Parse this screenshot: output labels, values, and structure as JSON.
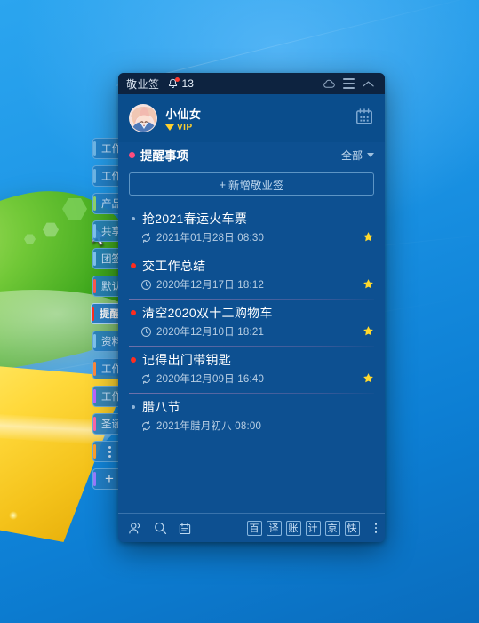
{
  "desktop": {
    "wallpaper_name": "windows-flag-wallpaper",
    "cursor": "arrow-cursor",
    "category_panel": {
      "items": [
        {
          "label": "工作",
          "accent": "#6fb8e8",
          "active": false
        },
        {
          "label": "工作",
          "accent": "#6fb8e8",
          "active": false
        },
        {
          "label": "产品",
          "accent": "#8fd46a",
          "active": false
        },
        {
          "label": "共享",
          "accent": "#7fc4ef",
          "active": false
        },
        {
          "label": "团签",
          "accent": "#7fc4ef",
          "active": false
        },
        {
          "label": "默认",
          "accent": "#ff5a4d",
          "active": false
        },
        {
          "label": "提醒事项",
          "accent": "#ff2d1f",
          "active": true
        },
        {
          "label": "资料",
          "accent": "#7fc4ef",
          "active": false
        },
        {
          "label": "工作",
          "accent": "#ff8a3d",
          "active": false
        },
        {
          "label": "工作",
          "accent": "#c062ff",
          "active": false
        },
        {
          "label": "圣诞",
          "accent": "#ff66a8",
          "active": false
        }
      ],
      "more_label": "more-categories",
      "add_label": "+"
    }
  },
  "app": {
    "titlebar": {
      "title": "敬业签",
      "bell_icon": "bell-icon",
      "notification_count": "13",
      "cloud_icon": "cloud-sync-icon",
      "menu_icon": "hamburger-menu-icon",
      "collapse_icon": "chevron-up-icon"
    },
    "user": {
      "avatar_icon": "user-avatar",
      "name": "小仙女",
      "vip_label": "VIP",
      "vip_icon": "diamond-icon",
      "vip_color": "#ffd02e",
      "calendar_icon": "calendar-icon"
    },
    "section": {
      "dot_color": "#ff4d7e",
      "title": "提醒事项",
      "filter_label": "全部",
      "filter_icon": "chevron-down-icon"
    },
    "add_button": {
      "plus": "+",
      "label": "新增敬业签"
    },
    "items": [
      {
        "title": "抢2021春运火车票",
        "date": "2021年01月28日 08:30",
        "bullet": "dim",
        "repeat_icon": "repeat-icon",
        "starred": true,
        "star_icon": "star-icon"
      },
      {
        "title": "交工作总结",
        "date": "2020年12月17日 18:12",
        "bullet": "red",
        "repeat_icon": "clock-icon",
        "starred": true,
        "star_icon": "star-icon"
      },
      {
        "title": "清空2020双十二购物车",
        "date": "2020年12月10日 18:21",
        "bullet": "red",
        "repeat_icon": "clock-icon",
        "starred": true,
        "star_icon": "star-icon"
      },
      {
        "title": "记得出门带钥匙",
        "date": "2020年12月09日 16:40",
        "bullet": "red",
        "repeat_icon": "repeat-icon",
        "starred": true,
        "star_icon": "star-icon"
      },
      {
        "title": "腊八节",
        "date": "2021年腊月初八 08:00",
        "bullet": "dim",
        "repeat_icon": "repeat-icon",
        "starred": false,
        "star_icon": "star-icon"
      }
    ],
    "bottombar": {
      "left_icons": [
        {
          "name": "contacts-icon"
        },
        {
          "name": "search-icon"
        },
        {
          "name": "calendar-icon"
        }
      ],
      "shortcuts": [
        "百",
        "译",
        "账",
        "计",
        "京",
        "快"
      ],
      "more_icon": "more-vertical-icon"
    }
  },
  "colors": {
    "titlebar_bg": "#0d2340",
    "window_bg": "#0d5091",
    "userbar_bg": "#0a4d8c",
    "accent_pink": "#ff4d7e",
    "star_yellow": "#ffd92e",
    "bullet_red": "#ff2d1f",
    "desktop_blue": "#1494e8"
  }
}
